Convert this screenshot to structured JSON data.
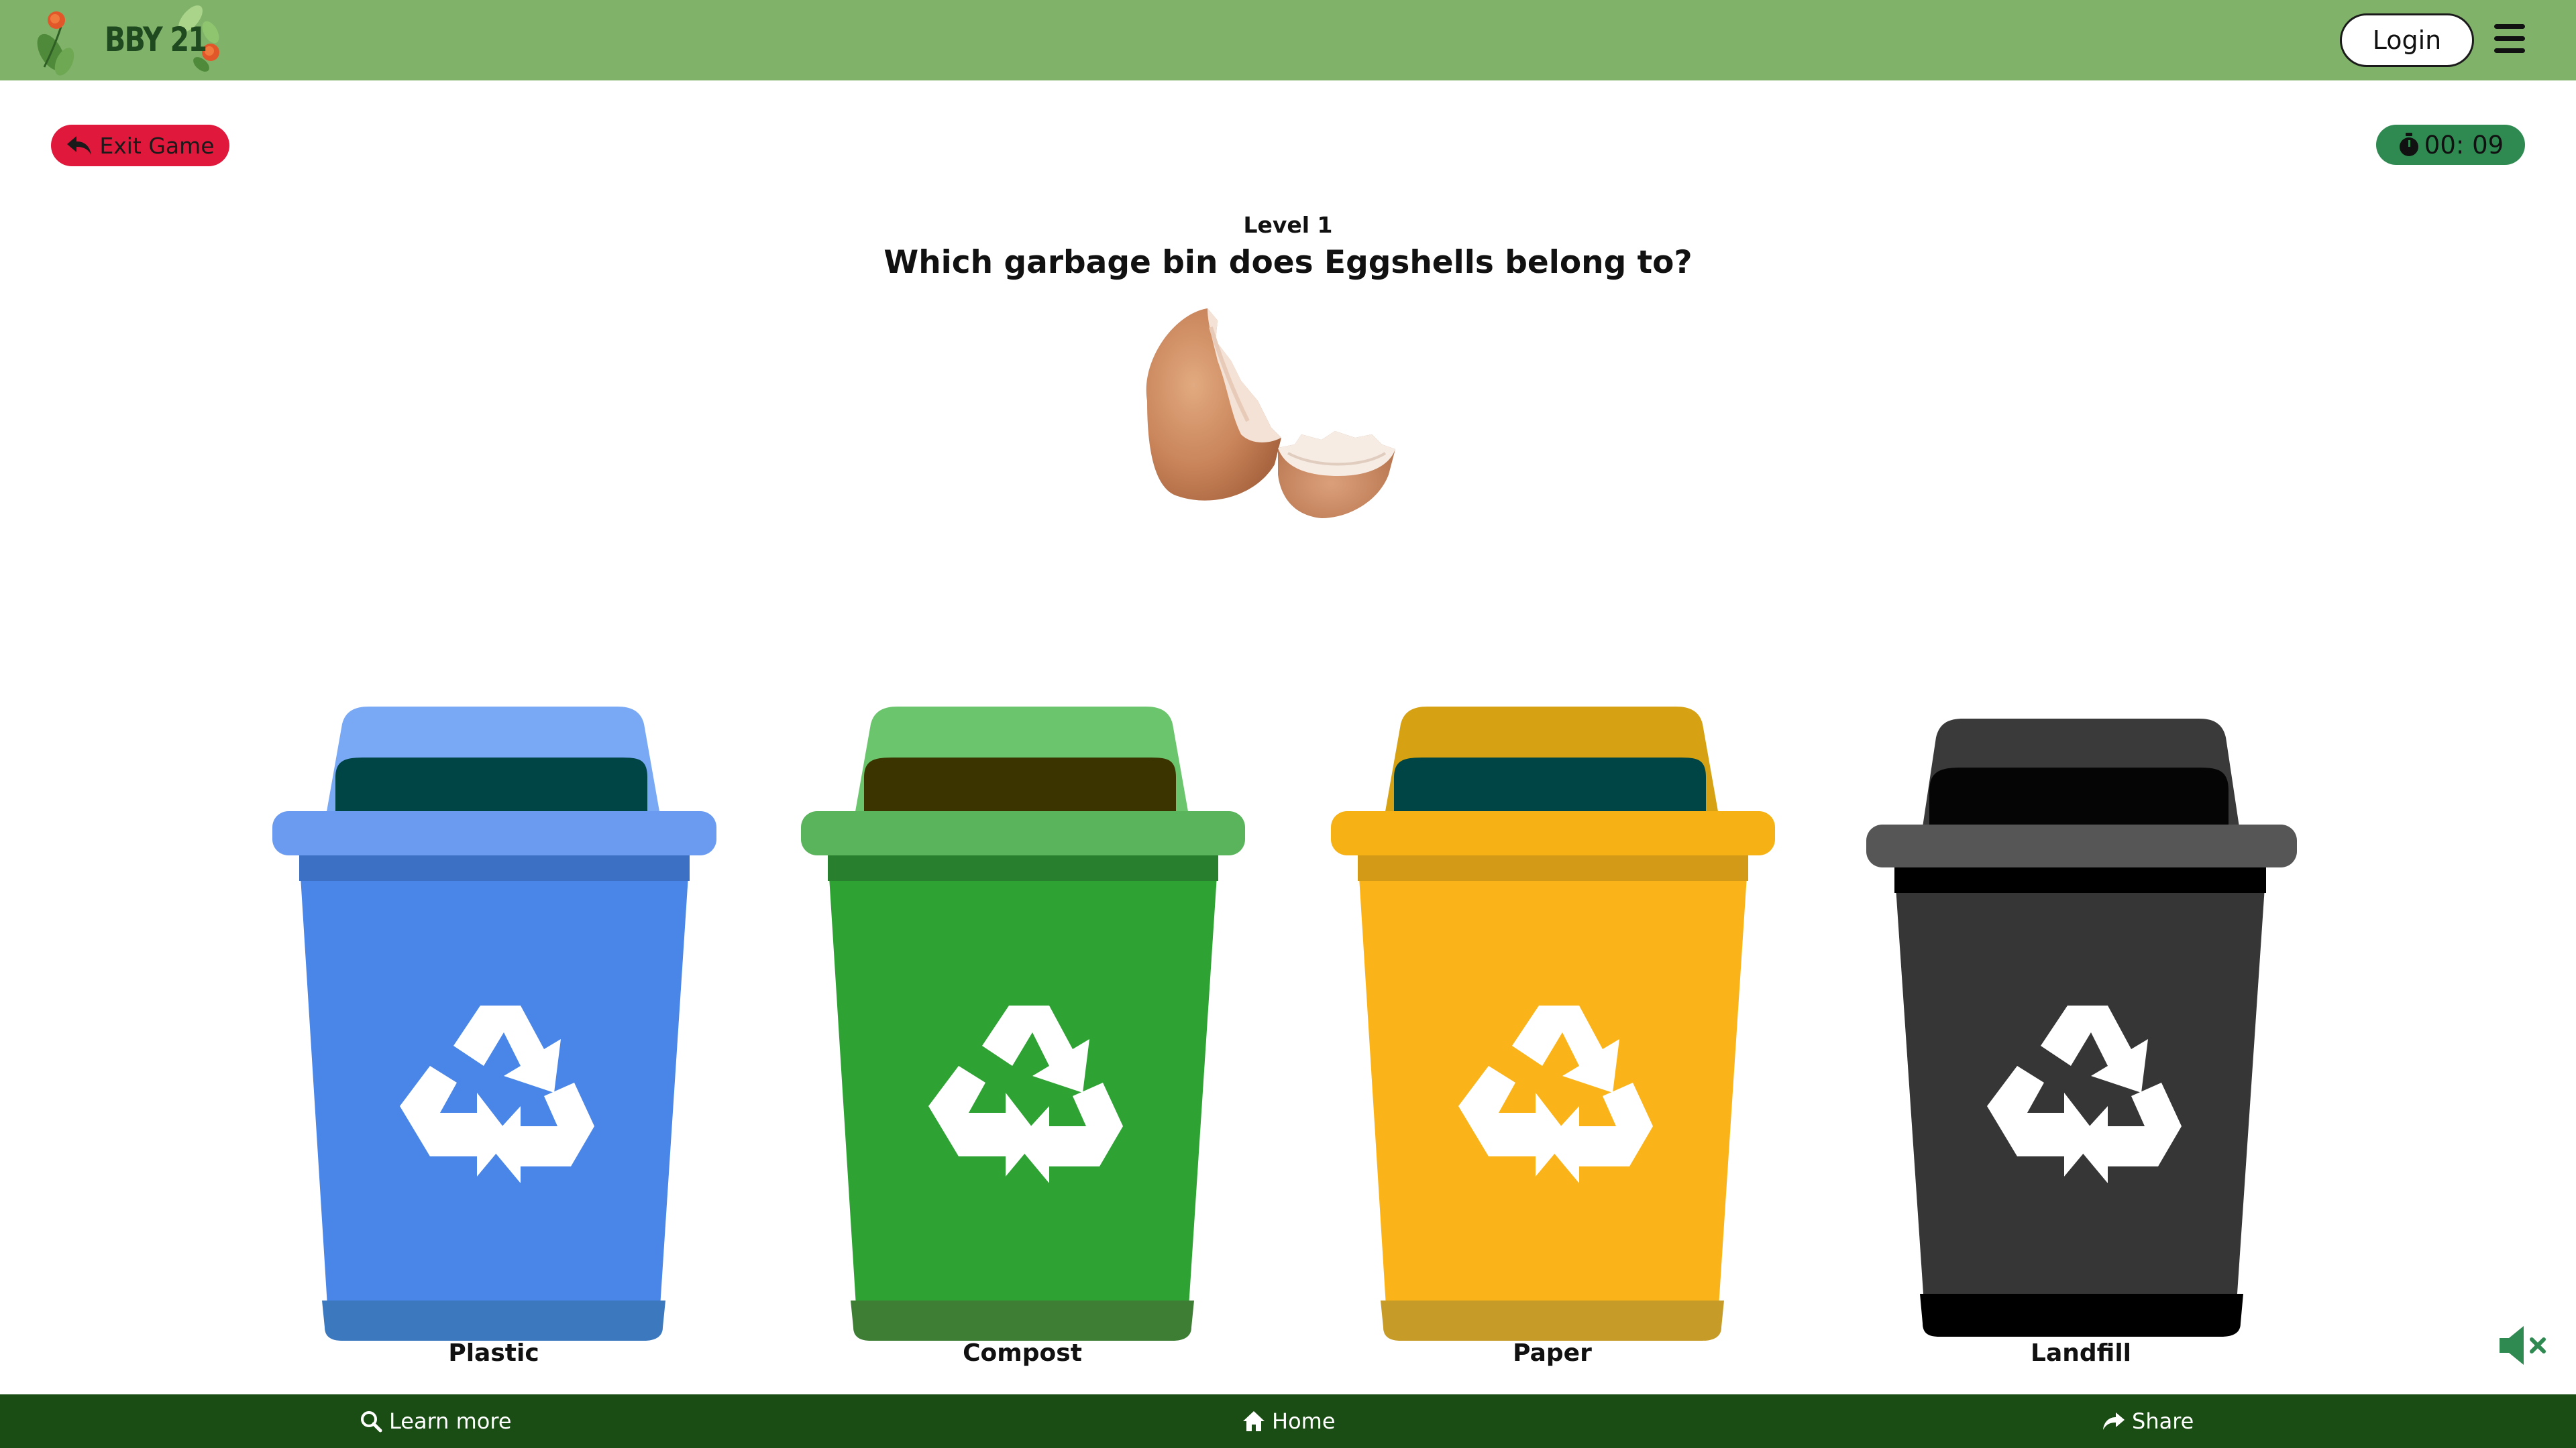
{
  "header": {
    "logo_text": "BBY 21",
    "login_label": "Login"
  },
  "game": {
    "exit_label": "Exit Game",
    "timer": "00: 09",
    "level": "Level 1",
    "question": "Which garbage bin does Eggshells belong to?",
    "item": "Eggshells"
  },
  "bins": [
    {
      "label": "Plastic",
      "color": "#4a86e8"
    },
    {
      "label": "Compost",
      "color": "#2ea334"
    },
    {
      "label": "Paper",
      "color": "#fbb31a"
    },
    {
      "label": "Landfill",
      "color": "#363636"
    }
  ],
  "footer": {
    "learn_more": "Learn more",
    "home": "Home",
    "share": "Share"
  },
  "icons": {
    "menu": "hamburger-icon",
    "exit": "reply-arrow-icon",
    "timer": "stopwatch-icon",
    "recycle": "recycle-icon",
    "mute": "speaker-muted-icon",
    "search": "search-icon",
    "home": "home-icon",
    "share": "share-arrow-icon"
  }
}
